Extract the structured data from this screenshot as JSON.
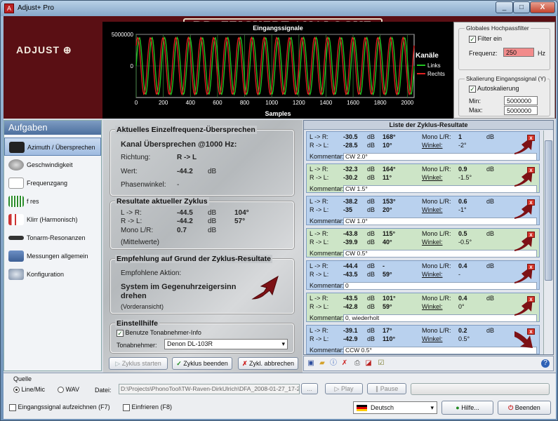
{
  "window": {
    "title": "Adjust+ Pro",
    "minimize": "_",
    "maximize": "□",
    "close": "X"
  },
  "header": {
    "brand": "DR. FEICKERT ANALOGUE",
    "app_logo": "ADJUST ⊕"
  },
  "signal_chart": {
    "title": "Eingangssignale",
    "xlabel": "Samples",
    "legend_title": "Kanäle"
  },
  "chart_data": {
    "type": "line",
    "title": "Eingangssignale",
    "xlabel": "Samples",
    "ylabel": "",
    "x_ticks": [
      "0",
      "200",
      "400",
      "600",
      "800",
      "1000",
      "1200",
      "1400",
      "1600",
      "1800",
      "2000"
    ],
    "y_ticks": [
      "5000000",
      "0"
    ],
    "xlim": [
      0,
      2050
    ],
    "ylim": [
      -5000000,
      5000000
    ],
    "grid": true,
    "legend_placement": "right",
    "series": [
      {
        "name": "Links",
        "color": "#22c322",
        "amplitude": 4500000,
        "cycles": 22,
        "phase": 0
      },
      {
        "name": "Rechts",
        "color": "#e02020",
        "amplitude": 4500000,
        "cycles": 22,
        "phase": 0.8
      }
    ]
  },
  "highpass": {
    "group_title": "Globales Hochpassfilter",
    "filter_label": "Filter ein",
    "freq_label": "Frequenz:",
    "freq_value": "250",
    "unit": "Hz"
  },
  "scaling": {
    "group_title": "Skalierung Eingangssignal (Y)",
    "auto_label": "Autoskalierung",
    "min_label": "Min:",
    "min_value": "5000000",
    "max_label": "Max:",
    "max_value": "5000000"
  },
  "sidebar": {
    "title": "Aufgaben",
    "items": [
      {
        "label": "Azimuth / Übersprechen",
        "icon": "azimuth-icon",
        "selected": true
      },
      {
        "label": "Geschwindigkeit",
        "icon": "speed-icon"
      },
      {
        "label": "Frequenzgang",
        "icon": "frequency-icon"
      },
      {
        "label": "f res",
        "icon": "resonance-icon"
      },
      {
        "label": "Klirr (Harmonisch)",
        "icon": "distortion-icon"
      },
      {
        "label": "Tonarm-Resonanzen",
        "icon": "tonearm-icon"
      },
      {
        "label": "Messungen allgemein",
        "icon": "measure-icon"
      },
      {
        "label": "Konfiguration",
        "icon": "config-icon"
      }
    ]
  },
  "single_freq": {
    "title": "Aktuelles Einzelfrequenz-Übersprechen",
    "channel_heading": "Kanal Übersprechen @1000 Hz:",
    "dir_label": "Richtung:",
    "dir_value": "R -> L",
    "value_label": "Wert:",
    "value": "-44.2",
    "value_unit": "dB",
    "phase_label": "Phasenwinkel:",
    "phase_value": "-"
  },
  "cycle_results": {
    "title": "Resultate aktueller Zyklus",
    "lr_label": "L -> R:",
    "lr_value": "-44.5",
    "lr_unit": "dB",
    "lr_angle": "104°",
    "rl_label": "R -> L:",
    "rl_value": "-44.2",
    "rl_unit": "dB",
    "rl_angle": "57°",
    "mono_label": "Mono L/R:",
    "mono_value": "0.7",
    "mono_unit": "dB",
    "mean_label": "(Mittelwerte)"
  },
  "recommendation": {
    "title": "Empfehlung auf Grund der Zyklus-Resultate",
    "action_label": "Empfohlene Aktion:",
    "action_line1": "System im Gegenuhrzeigersinn",
    "action_line2": "drehen",
    "note": "(Vorderansicht)"
  },
  "setup": {
    "title": "Einstellhilfe",
    "use_cartridge_label": "Benutze Tonabnehmer-Info",
    "cartridge_label": "Tonabnehmer:",
    "cartridge_value": "Denon DL-103R"
  },
  "cycle_buttons": {
    "start": "Zyklus starten",
    "end": "Zyklus beenden",
    "abort": "Zykl. abbrechen"
  },
  "cycle_list": {
    "title": "Liste der Zyklus-Resultate",
    "entries": [
      {
        "lr": "-30.5",
        "lr_angle": "168°",
        "rl": "-28.5",
        "rl_angle": "10°",
        "mono": "1",
        "winkel": "-2°",
        "comment": "CW 2.0°",
        "color": "blue",
        "arrow": "up"
      },
      {
        "lr": "-32.3",
        "lr_angle": "164°",
        "rl": "-30.2",
        "rl_angle": "11°",
        "mono": "0.9",
        "winkel": "-1.5°",
        "comment": "CW 1.5°",
        "color": "green",
        "arrow": "up"
      },
      {
        "lr": "-38.2",
        "lr_angle": "153°",
        "rl": "-35",
        "rl_angle": "20°",
        "mono": "0.6",
        "winkel": "-1°",
        "comment": "CW 1.0°",
        "color": "blue",
        "arrow": "up"
      },
      {
        "lr": "-43.8",
        "lr_angle": "115°",
        "rl": "-39.9",
        "rl_angle": "40°",
        "mono": "0.5",
        "winkel": "-0.5°",
        "comment": "CW 0.5°",
        "color": "green",
        "arrow": "up"
      },
      {
        "lr": "-44.4",
        "lr_angle": "-",
        "rl": "-43.5",
        "rl_angle": "59°",
        "mono": "0.4",
        "winkel": "-",
        "comment": "0",
        "color": "blue",
        "arrow": "up"
      },
      {
        "lr": "-43.5",
        "lr_angle": "101°",
        "rl": "-42.8",
        "rl_angle": "59°",
        "mono": "0.4",
        "winkel": "0°",
        "comment": "0, wiederholt",
        "color": "green",
        "arrow": "up"
      },
      {
        "lr": "-39.1",
        "lr_angle": "17°",
        "rl": "-42.9",
        "rl_angle": "110°",
        "mono": "0.2",
        "winkel": "0.5°",
        "comment": "CCW 0.5°",
        "color": "blue",
        "arrow": "down"
      }
    ],
    "labels": {
      "lr": "L -> R:",
      "rl": "R -> L:",
      "db": "dB",
      "mono": "Mono L/R:",
      "winkel": "Winkel:",
      "comment": "Kommentar:"
    }
  },
  "source": {
    "title": "Quelle",
    "line_label": "Line/Mic",
    "wav_label": "WAV",
    "file_label": "Datei:",
    "file_value": "D:\\Projects\\PhonoTool\\TW-Raven-DirkUlrich\\DFA_2008-01-27_17-2",
    "browse": "...",
    "play": "Play",
    "pause": "Pause"
  },
  "footer": {
    "record_label": "Eingangssignal aufzeichnen (F7)",
    "freeze_label": "Einfrieren (F8)",
    "language": "Deutsch",
    "help": "Hilfe...",
    "quit": "Beenden"
  }
}
